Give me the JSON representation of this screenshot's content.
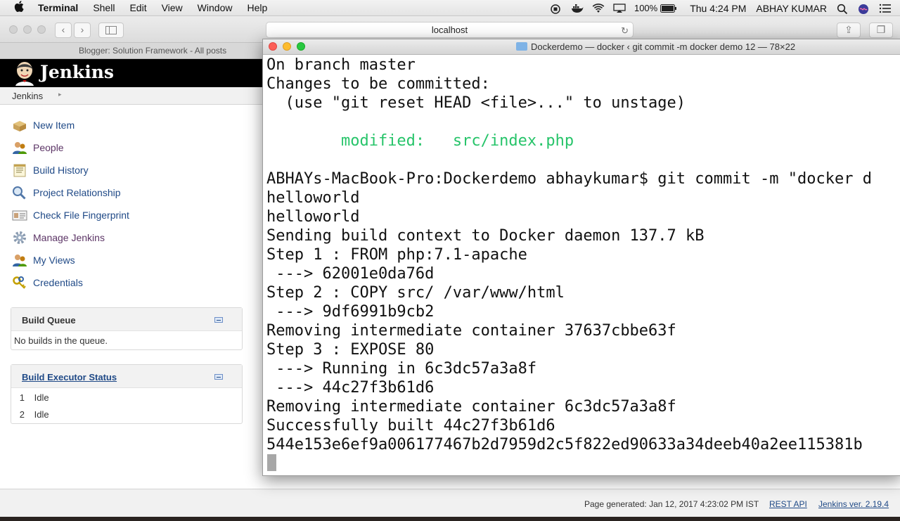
{
  "menubar": {
    "app": "Terminal",
    "menus": [
      "Shell",
      "Edit",
      "View",
      "Window",
      "Help"
    ],
    "battery": "100%",
    "clock": "Thu 4:24 PM",
    "user": "ABHAY KUMAR"
  },
  "safari": {
    "url": "localhost",
    "tab_title": "Blogger: Solution Framework - All posts"
  },
  "jenkins": {
    "title": "Jenkins",
    "breadcrumb": "Jenkins",
    "sidebar": [
      {
        "label": "New Item",
        "icon": "new-item-icon"
      },
      {
        "label": "People",
        "icon": "people-icon"
      },
      {
        "label": "Build History",
        "icon": "notepad-icon"
      },
      {
        "label": "Project Relationship",
        "icon": "magnifier-icon"
      },
      {
        "label": "Check File Fingerprint",
        "icon": "fingerprint-card-icon"
      },
      {
        "label": "Manage Jenkins",
        "icon": "gear-icon"
      },
      {
        "label": "My Views",
        "icon": "people-icon"
      },
      {
        "label": "Credentials",
        "icon": "keys-icon"
      }
    ],
    "build_queue": {
      "title": "Build Queue",
      "empty_text": "No builds in the queue."
    },
    "executor_status": {
      "title": "Build Executor Status",
      "executors": [
        {
          "num": "1",
          "status": "Idle"
        },
        {
          "num": "2",
          "status": "Idle"
        }
      ]
    },
    "footer": {
      "generated": "Page generated: Jan 12, 2017 4:23:02 PM IST",
      "rest_api": "REST API",
      "version": "Jenkins ver. 2.19.4"
    }
  },
  "terminal": {
    "title": "Dockerdemo — docker ‹ git commit -m docker demo 12 — 78×22",
    "lines": [
      {
        "text": "On branch master",
        "color": "default"
      },
      {
        "text": "Changes to be committed:",
        "color": "default"
      },
      {
        "text": "  (use \"git reset HEAD <file>...\" to unstage)",
        "color": "default"
      },
      {
        "text": "",
        "color": "default"
      },
      {
        "text": "        modified:   src/index.php",
        "color": "green"
      },
      {
        "text": "",
        "color": "default"
      },
      {
        "text": "ABHAYs-MacBook-Pro:Dockerdemo abhaykumar$ git commit -m \"docker d",
        "color": "default"
      },
      {
        "text": "helloworld",
        "color": "default"
      },
      {
        "text": "helloworld",
        "color": "default"
      },
      {
        "text": "Sending build context to Docker daemon 137.7 kB",
        "color": "default"
      },
      {
        "text": "Step 1 : FROM php:7.1-apache",
        "color": "default"
      },
      {
        "text": " ---> 62001e0da76d",
        "color": "default"
      },
      {
        "text": "Step 2 : COPY src/ /var/www/html",
        "color": "default"
      },
      {
        "text": " ---> 9df6991b9cb2",
        "color": "default"
      },
      {
        "text": "Removing intermediate container 37637cbbe63f",
        "color": "default"
      },
      {
        "text": "Step 3 : EXPOSE 80",
        "color": "default"
      },
      {
        "text": " ---> Running in 6c3dc57a3a8f",
        "color": "default"
      },
      {
        "text": " ---> 44c27f3b61d6",
        "color": "default"
      },
      {
        "text": "Removing intermediate container 6c3dc57a3a8f",
        "color": "default"
      },
      {
        "text": "Successfully built 44c27f3b61d6",
        "color": "default"
      },
      {
        "text": "544e153e6ef9a006177467b2d7959d2c5f822ed90633a34deeb40a2ee115381b",
        "color": "default"
      }
    ]
  },
  "colors": {
    "jenkins_link": "#204a87",
    "jenkins_visited": "#5c3566",
    "terminal_green": "#27c46a"
  }
}
